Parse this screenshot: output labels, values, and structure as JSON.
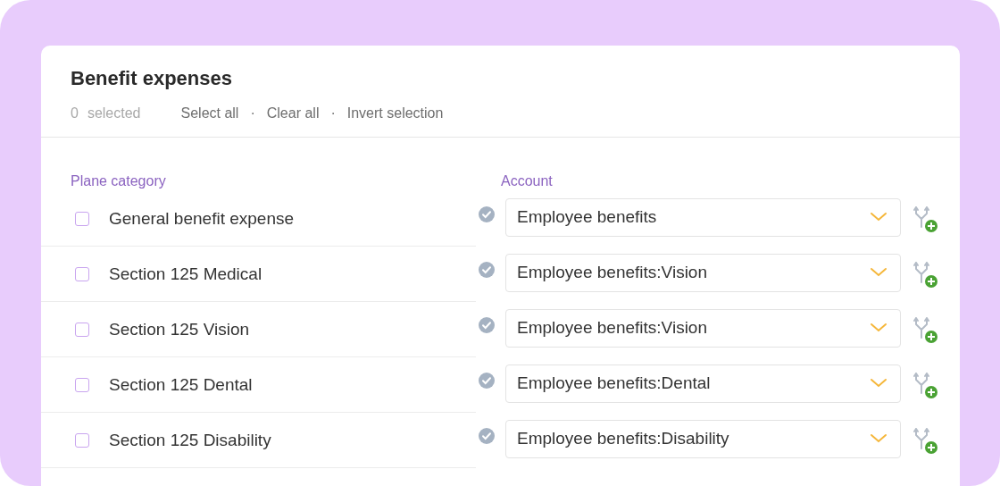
{
  "panel": {
    "title": "Benefit expenses",
    "selection": {
      "count": "0",
      "label": "selected",
      "actions": [
        "Select all",
        "Clear all",
        "Invert selection"
      ],
      "separator": "·"
    }
  },
  "columns": [
    "Plane category",
    "Account"
  ],
  "rows": [
    {
      "category": "General benefit expense",
      "checked": false,
      "account": "Employee benefits"
    },
    {
      "category": "Section 125 Medical",
      "checked": false,
      "account": "Employee benefits:Vision"
    },
    {
      "category": "Section 125 Vision",
      "checked": false,
      "account": "Employee benefits:Vision"
    },
    {
      "category": "Section 125 Dental",
      "checked": false,
      "account": "Employee benefits:Dental"
    },
    {
      "category": "Section 125 Disability",
      "checked": false,
      "account": "Employee benefits:Disability"
    }
  ]
}
